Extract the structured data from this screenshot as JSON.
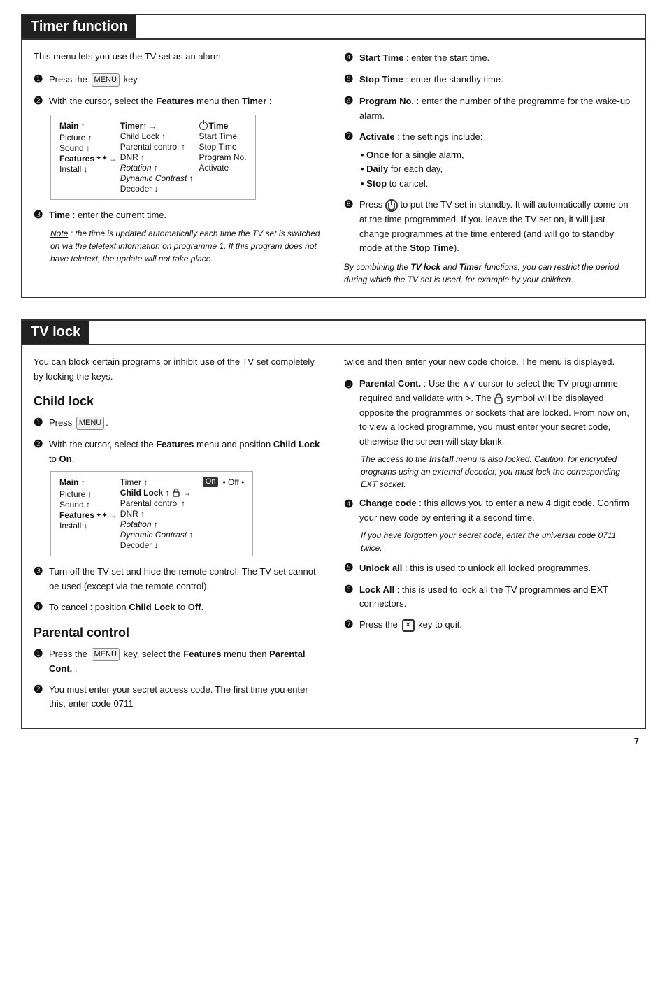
{
  "timerSection": {
    "title": "Timer function",
    "intro": "This menu lets you use the TV set as an alarm.",
    "steps_left": [
      {
        "num": "❶",
        "text": "Press the",
        "key": "MENU",
        "suffix": " key."
      },
      {
        "num": "❷",
        "bold1": "Features",
        "text": "With the cursor, select the",
        "text2": " menu then",
        "bold2": "Timer",
        "suffix": " :"
      },
      {
        "num": "❸",
        "bold": "Time",
        "suffix": " : enter the current time."
      }
    ],
    "note_label": "Note",
    "note_text": ": the time is updated automatically each time the TV set is switched on via the teletext information on programme 1. If this program does not have teletext, the update will not take place.",
    "steps_right": [
      {
        "num": "❹",
        "bold": "Start Time",
        "text": " : enter the start time."
      },
      {
        "num": "❺",
        "bold": "Stop Time",
        "text": " : enter the standby time."
      },
      {
        "num": "❻",
        "bold": "Program No.",
        "text": " : enter the number of the programme for the wake-up alarm."
      },
      {
        "num": "❼",
        "bold": "Activate",
        "text": " : the settings include:"
      },
      {
        "sub": [
          "Once for a single alarm,",
          "Daily for each day,",
          "Stop to cancel."
        ]
      },
      {
        "num": "❽",
        "text1": "Press ",
        "icon": "standby",
        "text2": " to put the TV set in standby. It will automatically come on at the time programmed. If you leave the TV set on, it will just change programmes at the time entered (and will go to standby mode at the ",
        "bold": "Stop Time",
        "text3": ")."
      },
      {
        "italic": "By combining the ",
        "bold1": "TV lock",
        "italic2": " and ",
        "bold2": "Timer",
        "italic3": " functions, you can restrict the period during which the TV set is used, for example by your children."
      }
    ],
    "diagram": {
      "main": [
        "Main",
        "Picture",
        "Sound",
        "Features",
        "Install"
      ],
      "features_arrow": "→",
      "sub": [
        "Timer",
        "Child Lock",
        "Parental control",
        "DNR",
        "Rotation",
        "Dynamic Contrast",
        "Decoder"
      ],
      "timer_arrow": "→",
      "sub2_bold": "Time",
      "sub2": [
        "Start Time",
        "Stop Time",
        "Program No.",
        "Activate"
      ]
    }
  },
  "tvlockSection": {
    "title": "TV lock",
    "intro": "You can block certain programs or inhibit use of the TV set completely by locking the keys.",
    "childlock": {
      "title": "Child lock",
      "steps": [
        {
          "num": "❶",
          "text": "Press ",
          "key": "MENU",
          "suffix": "."
        },
        {
          "num": "❷",
          "bold1": "Features",
          "text": "With the cursor, select the",
          "text2": " menu and position ",
          "bold2": "Child Lock",
          "text3": " to ",
          "bold3": "On",
          "suffix": "."
        }
      ],
      "diagram": {
        "main": [
          "Main",
          "Picture",
          "Sound",
          "Features",
          "Install"
        ],
        "sub": [
          "Timer",
          "Child Lock",
          "Parental control",
          "DNR",
          "Rotation",
          "Dynamic Contrast",
          "Decoder"
        ],
        "childlock_arrow": "→",
        "on_off": [
          "On",
          "Off"
        ]
      },
      "step3": {
        "num": "❸",
        "text": "Turn off the TV set and hide the remote control. The TV set cannot be used (except via the remote control)."
      },
      "step4": {
        "num": "❹",
        "text": "To cancel : position ",
        "bold1": "Child Lock",
        "text2": " to ",
        "bold2": "Off",
        "suffix": "."
      }
    },
    "parentalcontrol": {
      "title": "Parental control",
      "steps": [
        {
          "num": "❶",
          "text": "Press the ",
          "key": "MENU",
          "text2": " key, select the ",
          "bold1": "Features",
          "text3": " menu then ",
          "bold2": "Parental Cont.",
          "suffix": " :"
        },
        {
          "num": "❷",
          "text": "You must enter your secret access code. The first time you enter this, enter code 0711"
        }
      ]
    },
    "right_col": {
      "intro": "twice and then enter your new code choice. The menu is displayed.",
      "steps": [
        {
          "num": "❸",
          "bold": "Parental Cont.",
          "text": " : Use the ∧∨ cursor to select the TV programme required and validate with >. The ",
          "icon": "lock",
          "text2": " symbol will be displayed opposite the programmes or sockets that are locked. From now on, to view a locked programme, you must enter your secret code, otherwise the screen will stay blank."
        },
        {
          "italic": "The access to the ",
          "bold": "Install",
          "italic2": " menu is also locked. Caution, for encrypted programs using an external decoder, you must lock the corresponding EXT socket."
        },
        {
          "num": "❹",
          "bold": "Change code",
          "text": " : this allows you to enter a new 4 digit code. Confirm your new code by entering it a second time."
        },
        {
          "italic": "If you have forgotten your secret code, enter the universal code 0711 twice."
        },
        {
          "num": "❺",
          "bold": "Unlock all",
          "text": " : this is used to unlock all locked programmes."
        },
        {
          "num": "❻",
          "bold": "Lock All",
          "text": " : this is used to lock all the TV programmes and EXT connectors."
        },
        {
          "num": "❼",
          "text": "Press the ",
          "icon": "quit",
          "text2": " key to quit."
        }
      ]
    }
  },
  "pageNumber": "7"
}
